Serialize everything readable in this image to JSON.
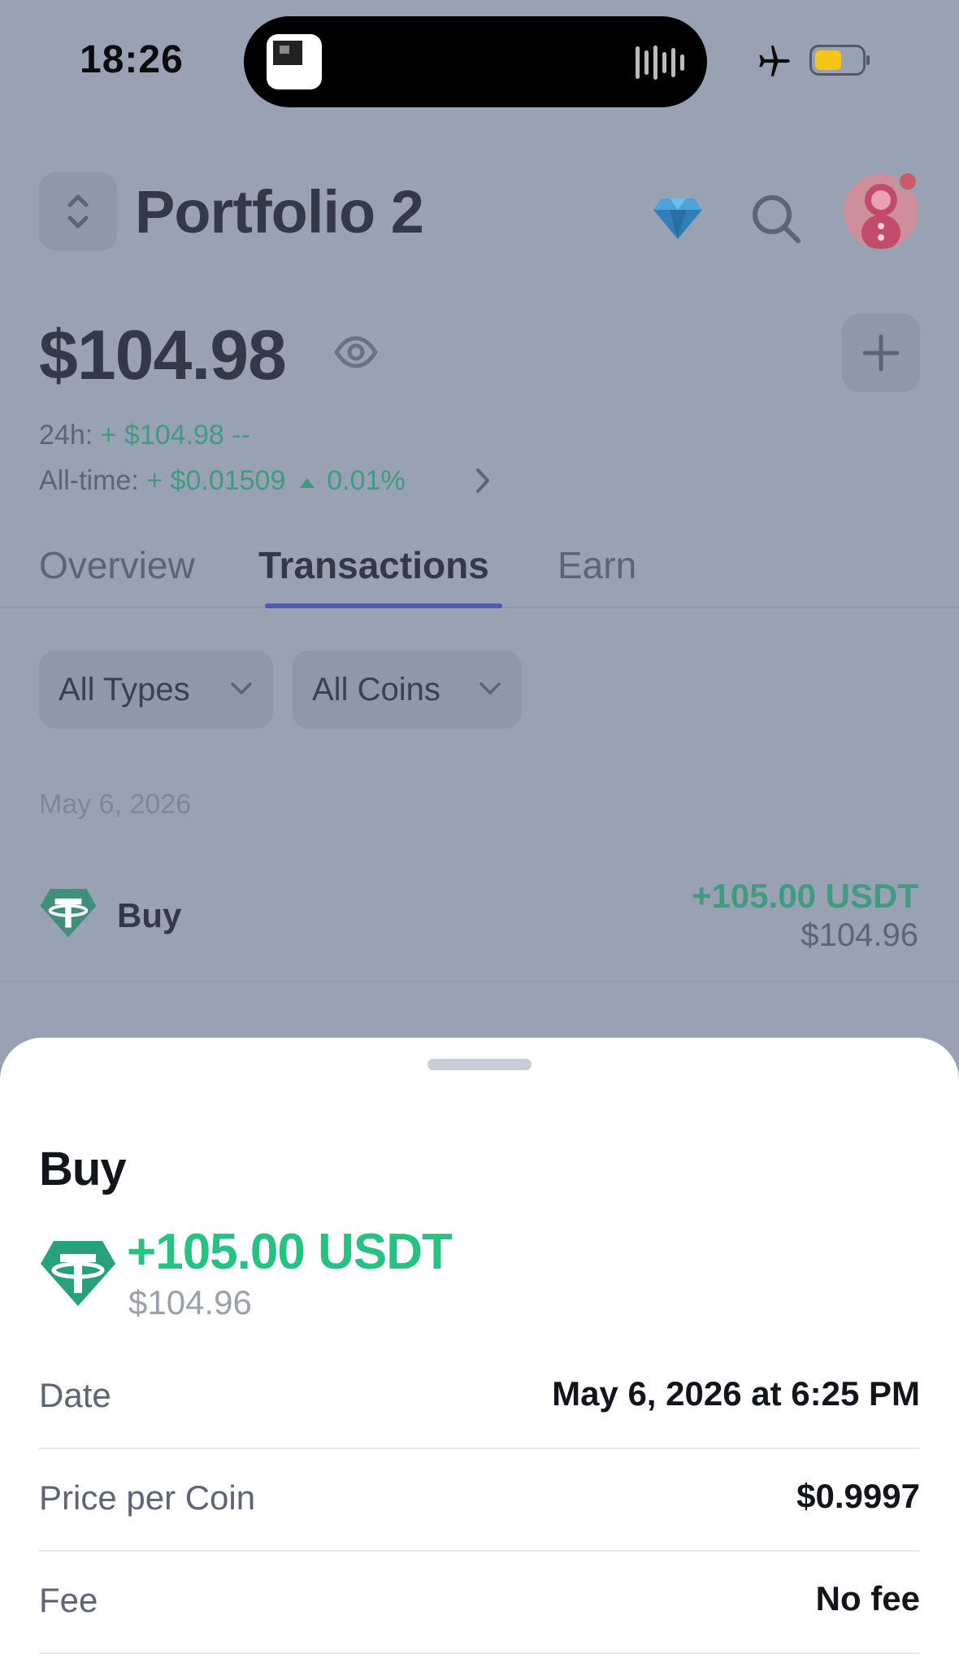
{
  "status_bar": {
    "time": "18:26"
  },
  "header": {
    "title": "Portfolio 2"
  },
  "balance": {
    "total": "$104.98",
    "change_24h_label": "24h:",
    "change_24h_value": "+ $104.98 --",
    "all_time_label": "All-time:",
    "all_time_value": "+ $0.01509",
    "all_time_percent": "0.01%"
  },
  "tabs": [
    {
      "label": "Overview"
    },
    {
      "label": "Transactions",
      "active": true
    },
    {
      "label": "Earn"
    }
  ],
  "filters": {
    "types": "All Types",
    "coins": "All Coins"
  },
  "transactions": {
    "date": "May 6, 2026",
    "items": [
      {
        "type": "Buy",
        "amount": "+105.00 USDT",
        "fiat": "$104.96",
        "coin_icon": "tether-icon"
      }
    ]
  },
  "sheet": {
    "title": "Buy",
    "amount": "+105.00 USDT",
    "fiat": "$104.96",
    "rows": [
      {
        "label": "Date",
        "value": "May 6, 2026 at 6:25 PM"
      },
      {
        "label": "Price per Coin",
        "value": "$0.9997"
      },
      {
        "label": "Fee",
        "value": "No fee"
      }
    ]
  },
  "colors": {
    "accent_green": "#26c281",
    "tether_green": "#26a17b",
    "tab_underline": "#4a5bb0",
    "overlay": "#99a2b2"
  }
}
